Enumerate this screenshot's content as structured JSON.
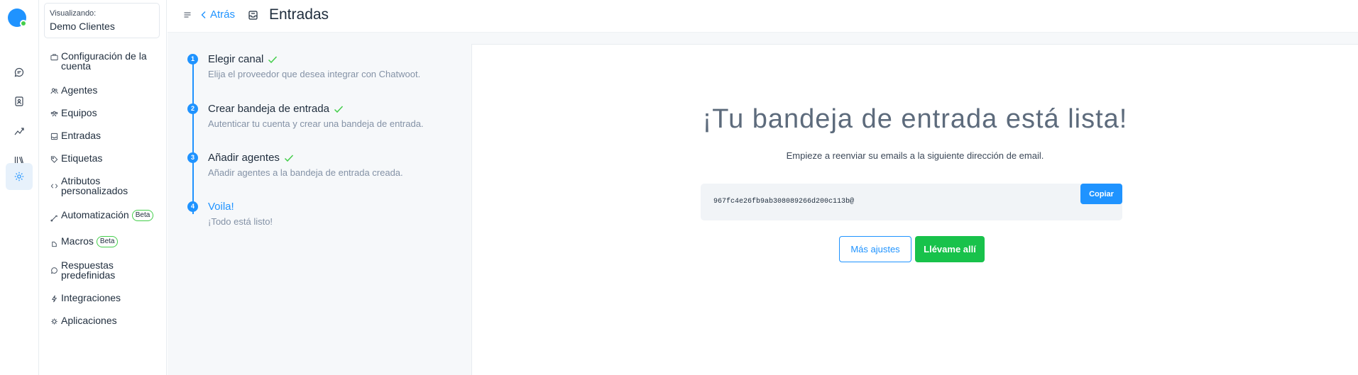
{
  "colors": {
    "primary": "#1f93ff",
    "success": "#44ce4b",
    "success_button": "#18c24b",
    "muted_text": "#8492a6",
    "background": "#f6f8fa"
  },
  "rail": {
    "icons": [
      "conversations-icon",
      "contacts-icon",
      "reports-icon",
      "library-icon",
      "settings-icon"
    ],
    "active": "settings-icon"
  },
  "account": {
    "label": "Visualizando:",
    "name": "Demo Clientes"
  },
  "sidebar": {
    "items": [
      {
        "label": "Configuración de la cuenta",
        "icon": "briefcase-icon"
      },
      {
        "label": "Agentes",
        "icon": "people-icon"
      },
      {
        "label": "Equipos",
        "icon": "team-icon"
      },
      {
        "label": "Entradas",
        "icon": "inbox-icon"
      },
      {
        "label": "Etiquetas",
        "icon": "tag-icon"
      },
      {
        "label": "Atributos personalizados",
        "icon": "code-icon"
      },
      {
        "label": "Automatización",
        "icon": "automation-icon",
        "badge": "Beta"
      },
      {
        "label": "Macros",
        "icon": "macro-icon",
        "badge": "Beta"
      },
      {
        "label": "Respuestas predefinidas",
        "icon": "chat-icon"
      },
      {
        "label": "Integraciones",
        "icon": "flash-icon"
      },
      {
        "label": "Aplicaciones",
        "icon": "apps-icon"
      }
    ]
  },
  "header": {
    "back_label": "Atrás",
    "title": "Entradas"
  },
  "wizard": {
    "steps": [
      {
        "number": "1",
        "title": "Elegir canal",
        "description": "Elija el proveedor que desea integrar con Chatwoot.",
        "completed": true
      },
      {
        "number": "2",
        "title": "Crear bandeja de entrada",
        "description": "Autenticar tu cuenta y crear una bandeja de entrada.",
        "completed": true
      },
      {
        "number": "3",
        "title": "Añadir agentes",
        "description": "Añadir agentes a la bandeja de entrada creada.",
        "completed": true
      },
      {
        "number": "4",
        "title": "Voila!",
        "description": "¡Todo está listo!",
        "completed": false
      }
    ]
  },
  "main": {
    "headline": "¡Tu bandeja de entrada está lista!",
    "subheadline": "Empieze a reenviar su emails a la siguiente dirección de email.",
    "email_address": "967fc4e26fb9ab308089266d200c113b@",
    "copy_label": "Copiar",
    "more_settings_label": "Más ajustes",
    "take_me_label": "Llévame allí"
  }
}
